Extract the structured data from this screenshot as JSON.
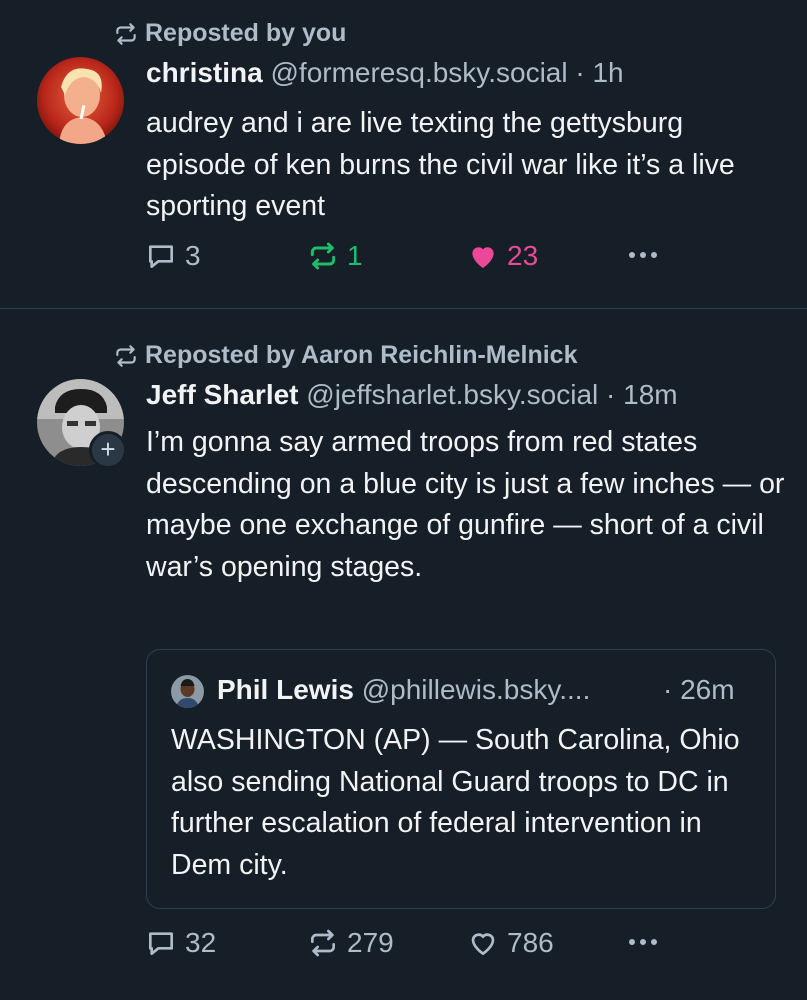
{
  "colors": {
    "background": "#161e27",
    "text_primary": "#f1f3f5",
    "text_secondary": "#aebbc9",
    "divider": "#2e4052",
    "like_active": "#ec4899",
    "repost_active": "#20bc6c"
  },
  "feed": [
    {
      "reposted_by": "Reposted by you",
      "author_name": "christina",
      "author_handle": "@formeresq.bsky.social",
      "separator": "·",
      "time": "1h",
      "text": "audrey and i are live texting the gettysburg episode of ken burns the civil war like it’s a live sporting event",
      "replies": "3",
      "reposts": "1",
      "likes": "23",
      "reposted": true,
      "liked": true
    },
    {
      "reposted_by": "Reposted by Aaron Reichlin-Melnick",
      "author_name": "Jeff Sharlet",
      "author_handle": "@jeffsharlet.bsky.social",
      "separator": "·",
      "time": "18m",
      "follow_badge": "+",
      "text": "I’m gonna say armed troops from red states descending on a blue city is just a few inches — or maybe one exchange of gunfire — short of a civil war’s opening stages.",
      "quote": {
        "author_name": "Phil Lewis",
        "author_handle": "@phillewis.bsky....",
        "time": "· 26m",
        "text": "WASHINGTON (AP) — South Carolina, Ohio also sending National Guard troops to DC in further escalation of federal intervention in Dem city."
      },
      "replies": "32",
      "reposts": "279",
      "likes": "786",
      "reposted": false,
      "liked": false
    }
  ],
  "icons": {
    "repost": "repost-icon",
    "reply": "reply-icon",
    "like": "heart-icon",
    "more": "more-options-icon"
  }
}
